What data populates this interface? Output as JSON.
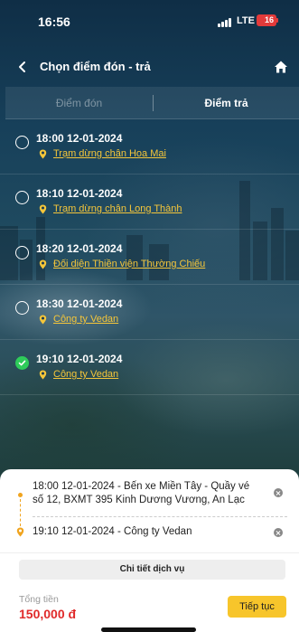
{
  "status_bar": {
    "time": "16:56",
    "network": "LTE",
    "battery": "16"
  },
  "header": {
    "title": "Chọn điểm đón - trả",
    "back_icon": "chevron-left-icon",
    "home_icon": "home-icon"
  },
  "tabs": [
    {
      "label": "Điểm đón",
      "active": false
    },
    {
      "label": "Điểm trả",
      "active": true
    }
  ],
  "stops": [
    {
      "time": "18:00 12-01-2024",
      "location": "Trạm dừng chân Hoa Mai",
      "selected": false
    },
    {
      "time": "18:10 12-01-2024",
      "location": "Trạm dừng chân Long Thành",
      "selected": false
    },
    {
      "time": "18:20 12-01-2024",
      "location": "Đối diện Thiền viện Thường Chiếu",
      "selected": false
    },
    {
      "time": "18:30 12-01-2024",
      "location": "Công ty Vedan",
      "selected": false
    },
    {
      "time": "19:10 12-01-2024",
      "location": "Công ty Vedan",
      "selected": true
    }
  ],
  "summary": {
    "pickup": "18:00 12-01-2024 - Bến xe Miền Tây - Quầy vé số 12, BXMT 395 Kinh Dương Vương, An Lạc",
    "dropoff": "19:10 12-01-2024 - Công ty Vedan",
    "service_details_label": "Chi tiết dịch vụ",
    "total_label": "Tổng tiền",
    "total_value": "150,000 đ",
    "continue_label": "Tiếp tục"
  },
  "colors": {
    "accent_yellow": "#f7c52b",
    "link_yellow": "#f5c63a",
    "price_red": "#e02a2a",
    "selected_green": "#2ecc5a",
    "battery_red": "#e23a3a"
  }
}
